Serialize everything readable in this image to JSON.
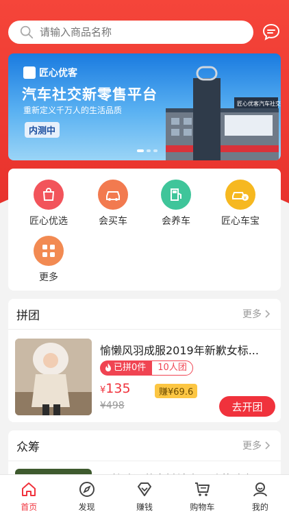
{
  "search": {
    "placeholder": "请输入商品名称"
  },
  "banner": {
    "brand": "匠心优客",
    "title": "汽车社交新零售平台",
    "subtitle": "重新定义千万人的生活品质",
    "tag": "内测中",
    "image_text": "匠心优客汽车社交新零售平台"
  },
  "menu": [
    {
      "label": "匠心优选",
      "color": "#f2545b",
      "icon": "shopping-bag-icon"
    },
    {
      "label": "会买车",
      "color": "#f27a4f",
      "icon": "car-icon"
    },
    {
      "label": "会养车",
      "color": "#3fc59a",
      "icon": "fuel-pump-icon"
    },
    {
      "label": "匠心车宝",
      "color": "#f6b820",
      "icon": "car-coin-icon"
    },
    {
      "label": "更多",
      "color": "#f28a52",
      "icon": "grid-icon"
    }
  ],
  "group_buy": {
    "title": "拼团",
    "more": "更多",
    "product": {
      "name": "愉懒风羽成服2019年新歉女标...",
      "joined": "已拼0件",
      "group_size": "10人团",
      "currency": "¥",
      "price": "135",
      "earn": "赚¥69.6",
      "old_price": "¥498",
      "action": "去开团"
    }
  },
  "crowdfund": {
    "title": "众筹",
    "more": "更多",
    "peek_text": "天然矿泽茗字椭镜崖风卧菠琦宫"
  },
  "tabs": [
    {
      "label": "首页",
      "icon": "home-icon",
      "active": true
    },
    {
      "label": "发现",
      "icon": "compass-icon",
      "active": false
    },
    {
      "label": "赚钱",
      "icon": "diamond-icon",
      "active": false
    },
    {
      "label": "购物车",
      "icon": "cart-icon",
      "active": false
    },
    {
      "label": "我的",
      "icon": "user-icon",
      "active": false
    }
  ],
  "colors": {
    "primary": "#f0323c",
    "header": "#ee3b31",
    "earn_badge": "#fcc643"
  }
}
